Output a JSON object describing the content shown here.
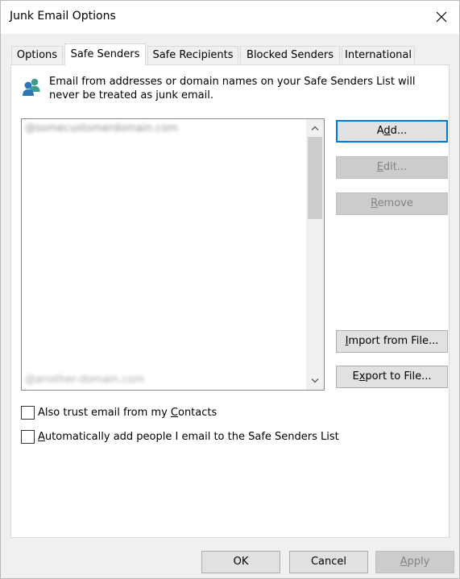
{
  "window": {
    "title": "Junk Email Options"
  },
  "tabs": [
    {
      "label": "Options",
      "active": false
    },
    {
      "label": "Safe Senders",
      "active": true
    },
    {
      "label": "Safe Recipients",
      "active": false
    },
    {
      "label": "Blocked Senders",
      "active": false
    },
    {
      "label": "International",
      "active": false
    }
  ],
  "panel": {
    "description": "Email from addresses or domain names on your Safe Senders List will never be treated as junk email.",
    "icon": "people-icon",
    "list": {
      "visible_items": [
        "@somecustomerdomain.com",
        "@another-domain.com"
      ]
    },
    "buttons": {
      "add": {
        "pre": "A",
        "key": "d",
        "post": "d...",
        "enabled": true
      },
      "edit": {
        "pre": "",
        "key": "E",
        "post": "dit...",
        "enabled": false
      },
      "remove": {
        "pre": "",
        "key": "R",
        "post": "emove",
        "enabled": false
      },
      "import": {
        "pre": "",
        "key": "I",
        "post": "mport from File...",
        "enabled": true
      },
      "export": {
        "pre": "E",
        "key": "x",
        "post": "port to File...",
        "enabled": true
      }
    },
    "checkboxes": {
      "trust_contacts": {
        "pre": "Also trust email from my ",
        "key": "C",
        "post": "ontacts",
        "checked": false
      },
      "auto_add": {
        "pre": "",
        "key": "A",
        "post": "utomatically add people I email to the Safe Senders List",
        "checked": false
      }
    }
  },
  "footer": {
    "ok": "OK",
    "cancel": "Cancel",
    "apply": {
      "key": "A",
      "post": "pply",
      "enabled": false
    }
  },
  "colors": {
    "accent": "#0078d7",
    "icon_blue": "#2e75b6",
    "icon_teal": "#3a9e8f"
  }
}
